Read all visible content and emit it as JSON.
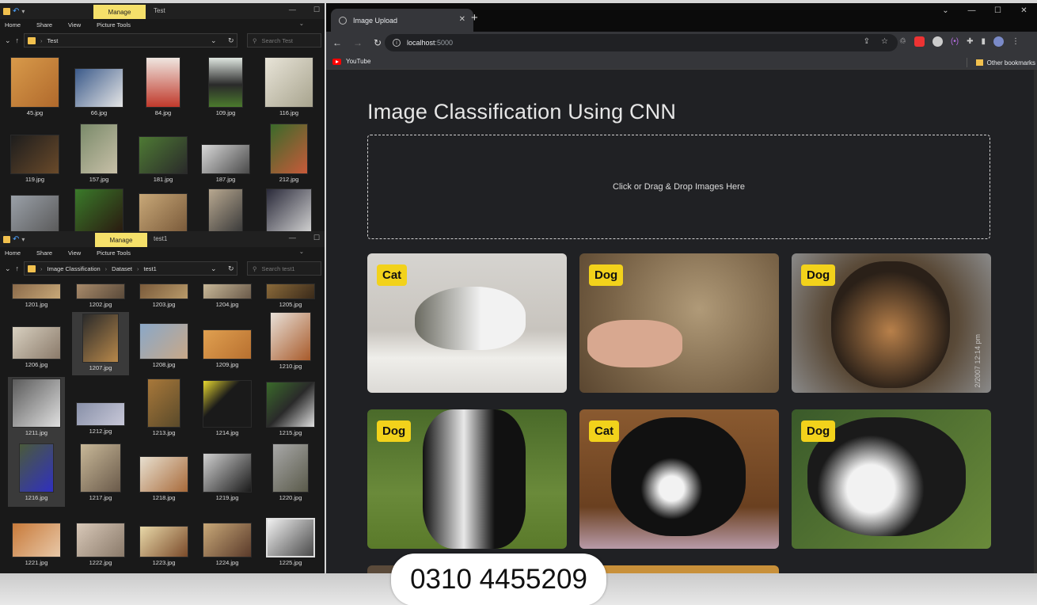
{
  "explorer_top": {
    "manage_label": "Manage",
    "window_title": "Test",
    "ribbon": [
      "Home",
      "Share",
      "View",
      "Picture Tools"
    ],
    "path": [
      "Test"
    ],
    "search_placeholder": "Search Test",
    "files": [
      "45.jpg",
      "66.jpg",
      "84.jpg",
      "109.jpg",
      "116.jpg",
      "119.jpg",
      "157.jpg",
      "181.jpg",
      "187.jpg",
      "212.jpg"
    ]
  },
  "explorer_bottom": {
    "manage_label": "Manage",
    "window_title": "test1",
    "ribbon": [
      "Home",
      "Share",
      "View",
      "Picture Tools"
    ],
    "path": [
      "Image Classification",
      "Dataset",
      "test1"
    ],
    "search_placeholder": "Search test1",
    "files": [
      "1201.jpg",
      "1202.jpg",
      "1203.jpg",
      "1204.jpg",
      "1205.jpg",
      "1206.jpg",
      "1207.jpg",
      "1208.jpg",
      "1209.jpg",
      "1210.jpg",
      "1211.jpg",
      "1212.jpg",
      "1213.jpg",
      "1214.jpg",
      "1215.jpg",
      "1216.jpg",
      "1217.jpg",
      "1218.jpg",
      "1219.jpg",
      "1220.jpg",
      "1221.jpg",
      "1222.jpg",
      "1223.jpg",
      "1224.jpg",
      "1225.jpg"
    ]
  },
  "browser": {
    "tab_title": "Image Upload",
    "url_host": "localhost",
    "url_port": ":5000",
    "bookmark": "YouTube",
    "other_bookmarks": "Other bookmarks"
  },
  "page": {
    "title": "Image Classification Using CNN",
    "dropzone_text": "Click or Drag & Drop Images Here",
    "results": [
      {
        "label": "Cat",
        "bg": "#b9b6b1"
      },
      {
        "label": "Dog",
        "bg": "#8c7a62"
      },
      {
        "label": "Dog",
        "bg": "#4d4236"
      },
      {
        "label": "Dog",
        "bg": "#5c7a3a"
      },
      {
        "label": "Cat",
        "bg": "#6e4a2a"
      },
      {
        "label": "Dog",
        "bg": "#4f6a38"
      }
    ],
    "stamp": "2/2007 12:14 pm"
  },
  "overlay_phone": "0310 4455209",
  "colors": {
    "badge": "#f2d21b",
    "manage_tab": "#f5e06a",
    "page_bg": "#202124"
  }
}
